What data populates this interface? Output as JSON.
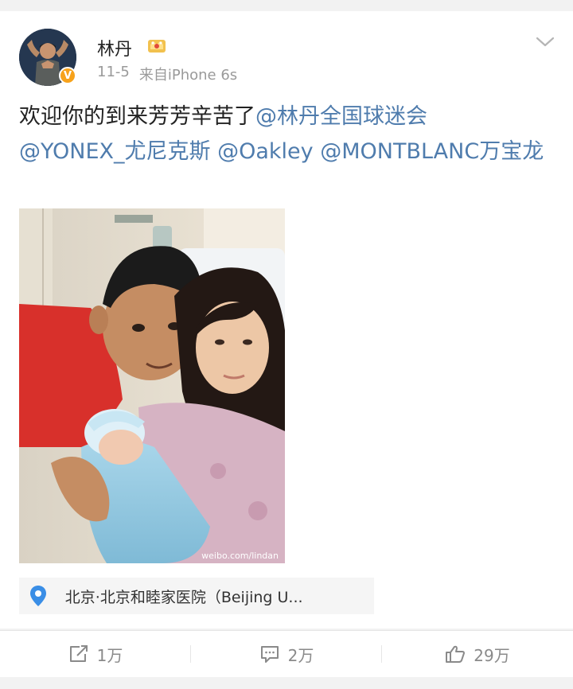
{
  "author": {
    "name": "林丹",
    "time": "11-5",
    "source": "来自iPhone 6s"
  },
  "post": {
    "text": "欢迎你的到来芳芳辛苦了",
    "mentions": [
      "@林丹全国球迷会",
      "@YONEX_尤尼克斯",
      "@Oakley",
      "@MONTBLANC万宝龙"
    ],
    "photo_watermark": "weibo.com/lindan"
  },
  "location": {
    "text": "北京·北京和睦家医院（Beijing U..."
  },
  "actions": {
    "repost_count": "1万",
    "comment_count": "2万",
    "like_count": "29万"
  },
  "colors": {
    "mention": "#4f7cad",
    "verified_badge": "#f7a21b",
    "location_pin": "#3a8ee6"
  },
  "icons": {
    "verified": "verified-badge-icon",
    "member": "crown-icon",
    "menu": "chevron-down-icon",
    "location": "location-pin-icon",
    "repost": "repost-icon",
    "comment": "comment-icon",
    "like": "thumbs-up-icon"
  }
}
